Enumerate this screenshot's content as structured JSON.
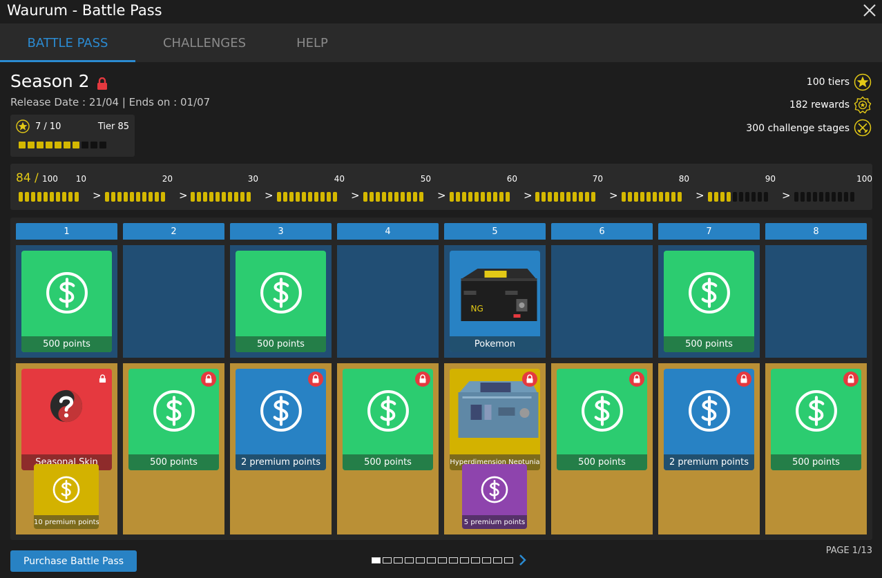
{
  "window": {
    "title": "Waurum - Battle Pass"
  },
  "tabs": [
    {
      "label": "BATTLE PASS",
      "active": true
    },
    {
      "label": "CHALLENGES",
      "active": false
    },
    {
      "label": "HELP",
      "active": false
    }
  ],
  "season": {
    "title": "Season 2",
    "release": "Release Date : 21/04 | Ends on : 01/07",
    "tier_progress": "7 / 10",
    "tier_label": "Tier 85",
    "tier_progress_value": 7,
    "tier_progress_max": 10
  },
  "stats": [
    {
      "label": "100 tiers",
      "icon": "star-icon"
    },
    {
      "label": "182 rewards",
      "icon": "badge-icon"
    },
    {
      "label": "300 challenge stages",
      "icon": "crossed-swords-icon"
    }
  ],
  "track": {
    "current": "84 /",
    "max": "100",
    "current_value": 84,
    "markers": [
      "10",
      "20",
      "30",
      "40",
      "50",
      "60",
      "70",
      "80",
      "90",
      "100"
    ]
  },
  "columns": [
    {
      "number": "1",
      "free": {
        "label": "500 points",
        "color": "green",
        "icon": "dollar-coin-icon"
      },
      "premium": {
        "label": "Seasonal Skin",
        "color": "red",
        "icon": "question-mark-icon",
        "locked": true,
        "lock_style": "small"
      },
      "extra": {
        "label": "10 premium points",
        "color": "yellow",
        "icon": "dollar-coin-icon"
      }
    },
    {
      "number": "2",
      "free": null,
      "premium": {
        "label": "500 points",
        "color": "green",
        "icon": "dollar-coin-icon",
        "locked": true
      }
    },
    {
      "number": "3",
      "free": {
        "label": "500 points",
        "color": "green",
        "icon": "dollar-coin-icon"
      },
      "premium": {
        "label": "2 premium points",
        "color": "blue",
        "icon": "dollar-coin-icon",
        "locked": true
      }
    },
    {
      "number": "4",
      "free": null,
      "premium": {
        "label": "500 points",
        "color": "green",
        "icon": "dollar-coin-icon",
        "locked": true
      }
    },
    {
      "number": "5",
      "free": {
        "label": "Pokemon",
        "color": "blue",
        "icon": "pokemon-chest-icon"
      },
      "premium": {
        "label": "Hyperdimension Neptunia",
        "color": "yellow",
        "icon": "neptunia-chest-icon",
        "locked": true
      },
      "extra": {
        "label": "5 premium points",
        "color": "purple",
        "icon": "dollar-coin-icon"
      }
    },
    {
      "number": "6",
      "free": null,
      "premium": {
        "label": "500 points",
        "color": "green",
        "icon": "dollar-coin-icon",
        "locked": true
      }
    },
    {
      "number": "7",
      "free": {
        "label": "500 points",
        "color": "green",
        "icon": "dollar-coin-icon"
      },
      "premium": {
        "label": "2 premium points",
        "color": "blue",
        "icon": "dollar-coin-icon",
        "locked": true
      }
    },
    {
      "number": "8",
      "free": null,
      "premium": {
        "label": "500 points",
        "color": "green",
        "icon": "dollar-coin-icon",
        "locked": true
      }
    }
  ],
  "footer": {
    "purchase_label": "Purchase Battle Pass",
    "page_label": "PAGE 1/13",
    "current_page": 1,
    "total_pages": 13
  },
  "colors": {
    "accent": "#2882c4",
    "gold": "#e3c916",
    "green": "#2ccc70",
    "red": "#e5393f",
    "yellow": "#d3b200",
    "purple": "#8e44ad",
    "free_row": "#214e74",
    "premium_row": "#ba9036"
  }
}
